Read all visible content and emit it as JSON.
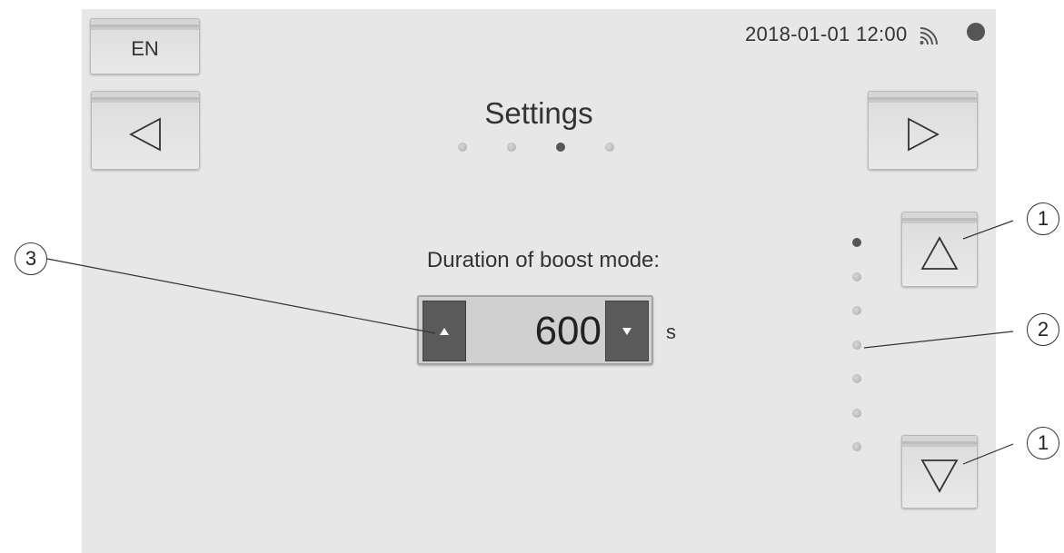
{
  "header": {
    "language": "EN",
    "datetime": "2018-01-01 12:00"
  },
  "icons": {
    "wifi": "wifi-icon",
    "status": "status-dot-icon",
    "nav_prev": "triangle-left-icon",
    "nav_next": "triangle-right-icon",
    "scroll_up": "triangle-up-icon",
    "scroll_down": "triangle-down-icon"
  },
  "page": {
    "title": "Settings",
    "page_count": 4,
    "active_page": 3
  },
  "parameter": {
    "label": "Duration of boost mode:",
    "value": "600",
    "unit": "s"
  },
  "scroll": {
    "item_count": 7,
    "active_item": 1
  },
  "callouts": {
    "up_button": "1",
    "scroll_indicator": "2",
    "spin_button": "3",
    "down_button": "1"
  },
  "colors": {
    "screen_bg": "#e7e7e7",
    "spin_button": "#5a5a5a",
    "active_dot": "#555555"
  }
}
